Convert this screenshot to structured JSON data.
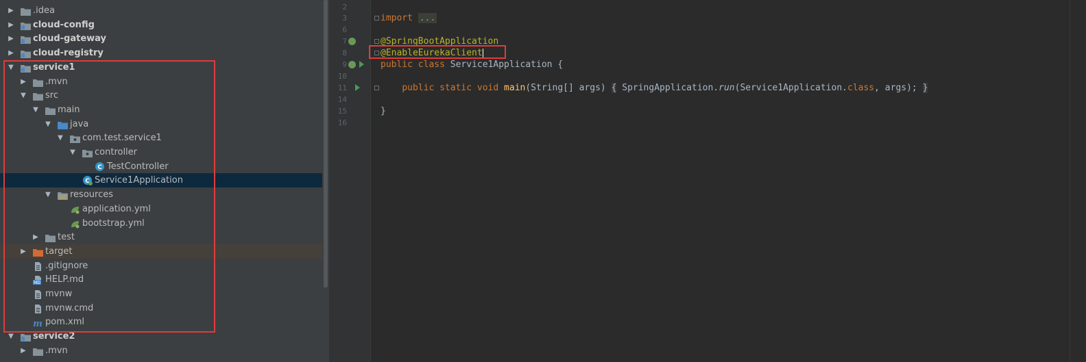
{
  "project_tree": {
    "top_partial_label": "",
    "rows": [
      {
        "label": ".idea",
        "depth": 1,
        "arrow": "▶",
        "icon": "folder-icon",
        "bold": false
      },
      {
        "label": "cloud-config",
        "depth": 1,
        "arrow": "▶",
        "icon": "module-folder-icon",
        "bold": true
      },
      {
        "label": "cloud-gateway",
        "depth": 1,
        "arrow": "▶",
        "icon": "module-folder-icon",
        "bold": true
      },
      {
        "label": "cloud-registry",
        "depth": 1,
        "arrow": "▶",
        "icon": "module-folder-icon",
        "bold": true
      },
      {
        "label": "service1",
        "depth": 1,
        "arrow": "▼",
        "icon": "module-folder-icon",
        "bold": true
      },
      {
        "label": ".mvn",
        "depth": 2,
        "arrow": "▶",
        "icon": "folder-icon",
        "bold": false
      },
      {
        "label": "src",
        "depth": 2,
        "arrow": "▼",
        "icon": "folder-icon",
        "bold": false
      },
      {
        "label": "main",
        "depth": 3,
        "arrow": "▼",
        "icon": "folder-icon",
        "bold": false
      },
      {
        "label": "java",
        "depth": 4,
        "arrow": "▼",
        "icon": "source-folder-icon",
        "bold": false
      },
      {
        "label": "com.test.service1",
        "depth": 5,
        "arrow": "▼",
        "icon": "package-icon",
        "bold": false
      },
      {
        "label": "controller",
        "depth": 6,
        "arrow": "▼",
        "icon": "package-icon",
        "bold": false
      },
      {
        "label": "TestController",
        "depth": 7,
        "arrow": "",
        "icon": "java-class-icon",
        "bold": false
      },
      {
        "label": "Service1Application",
        "depth": 6,
        "arrow": "",
        "icon": "spring-boot-class-icon",
        "bold": false
      },
      {
        "label": "resources",
        "depth": 4,
        "arrow": "▼",
        "icon": "resources-folder-icon",
        "bold": false
      },
      {
        "label": "application.yml",
        "depth": 5,
        "arrow": "",
        "icon": "spring-yml-icon",
        "bold": false
      },
      {
        "label": "bootstrap.yml",
        "depth": 5,
        "arrow": "",
        "icon": "spring-yml-icon",
        "bold": false
      },
      {
        "label": "test",
        "depth": 3,
        "arrow": "▶",
        "icon": "folder-icon",
        "bold": false
      },
      {
        "label": "target",
        "depth": 2,
        "arrow": "▶",
        "icon": "excluded-folder-icon",
        "bold": false
      },
      {
        "label": ".gitignore",
        "depth": 2,
        "arrow": "",
        "icon": "text-file-icon",
        "bold": false
      },
      {
        "label": "HELP.md",
        "depth": 2,
        "arrow": "",
        "icon": "markdown-file-icon",
        "bold": false
      },
      {
        "label": "mvnw",
        "depth": 2,
        "arrow": "",
        "icon": "text-file-icon",
        "bold": false
      },
      {
        "label": "mvnw.cmd",
        "depth": 2,
        "arrow": "",
        "icon": "text-file-icon",
        "bold": false
      },
      {
        "label": "pom.xml",
        "depth": 2,
        "arrow": "",
        "icon": "maven-icon",
        "bold": false
      },
      {
        "label": "service2",
        "depth": 1,
        "arrow": "▼",
        "icon": "module-folder-icon",
        "bold": true
      },
      {
        "label": ".mvn",
        "depth": 2,
        "arrow": "▶",
        "icon": "folder-icon",
        "bold": false
      }
    ],
    "selected_label": "Service1Application"
  },
  "editor": {
    "line_numbers": [
      "2",
      "3",
      "6",
      "7",
      "8",
      "9",
      "10",
      "11",
      "14",
      "15",
      "16"
    ],
    "code": {
      "import_kw": "import",
      "import_fold": "...",
      "ann_springboot": "@SpringBootApplication",
      "ann_eureka": "@EnableEurekaClient",
      "class_public": "public",
      "class_kw": "class",
      "class_name": "Service1Application {",
      "m_public": "public",
      "m_static": "static",
      "m_void": "void",
      "m_name": "main",
      "m_params": "(String[] args)",
      "m_open": "{",
      "m_body_a": " SpringApplication.",
      "m_run": "run",
      "m_body_b": "(Service1Application.",
      "m_class": "class",
      "m_body_c": ", args);",
      "m_close": "}",
      "class_close": "}"
    }
  },
  "colors": {
    "highlight_red": "#e03c3c",
    "sidebar_bg": "#3c3f41",
    "editor_bg": "#2b2b2b",
    "selection_bg": "#0d293e",
    "keyword": "#cc7832",
    "annotation": "#bbb529",
    "method": "#ffc66d"
  }
}
